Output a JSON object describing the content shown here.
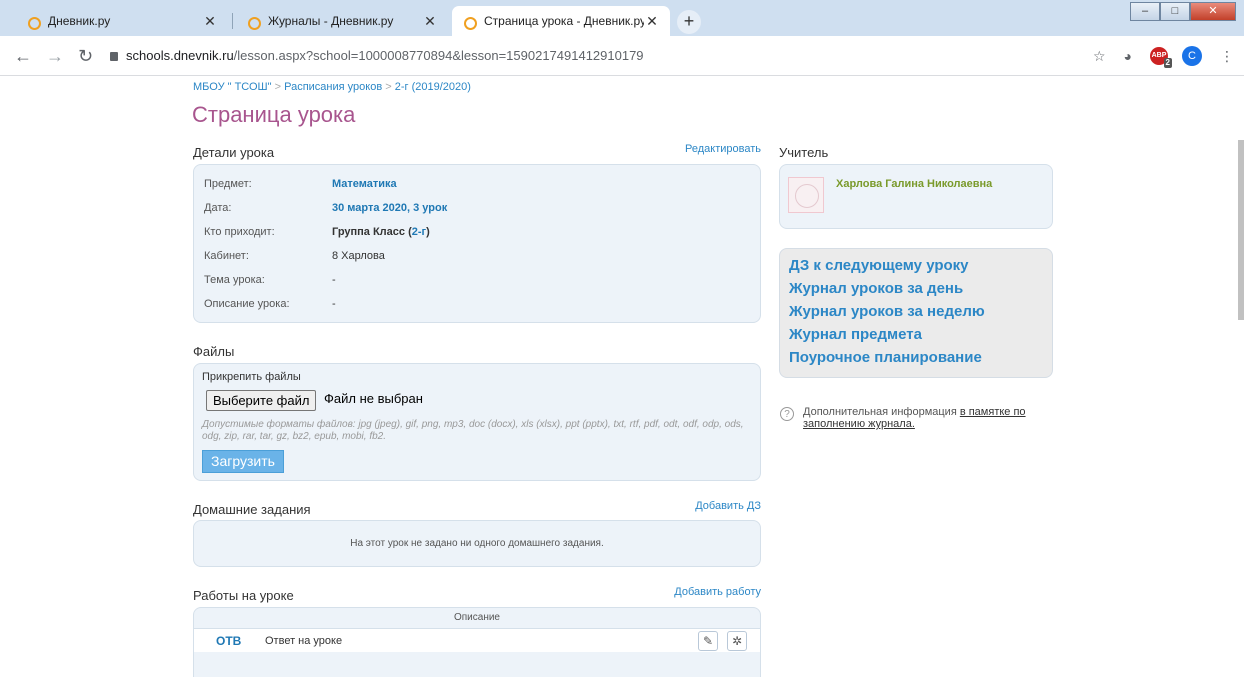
{
  "browser": {
    "tabs": [
      {
        "label": "Дневник.ру"
      },
      {
        "label": "Журналы - Дневник.ру"
      },
      {
        "label": "Страница урока - Дневник.ру"
      }
    ],
    "url_host": "schools.dnevnik.ru",
    "url_path": "/lesson.aspx?school=1000008770894&lesson=1590217491412910179",
    "abp_badge": "2",
    "profile_letter": "C"
  },
  "breadcrumb": {
    "items": [
      "МБОУ \" ТСОШ\"",
      "Расписания уроков",
      "2-г (2019/2020)"
    ],
    "separator": ">"
  },
  "page_title": "Страница урока",
  "details": {
    "heading": "Детали урока",
    "edit_link": "Редактировать",
    "rows": [
      {
        "label": "Предмет:",
        "value": "Математика"
      },
      {
        "label": "Дата:",
        "value": "30 марта 2020, 3 урок"
      },
      {
        "label": "Кто приходит:",
        "value_prefix": "Группа Класс (",
        "value_link": "2-г",
        "value_suffix": ")"
      },
      {
        "label": "Кабинет:",
        "value": "8 Харлова"
      },
      {
        "label": "Тема урока:",
        "value": "-"
      },
      {
        "label": "Описание урока:",
        "value": "-"
      }
    ]
  },
  "files": {
    "heading": "Файлы",
    "attach_label": "Прикрепить файлы",
    "choose_button": "Выберите файл",
    "no_file": "Файл не выбран",
    "formats_prefix": "Допустимые форматы файлов: ",
    "formats_list": "jpg (jpeg), gif, png, mp3, doc (docx), xls (xlsx), ppt (pptx), txt, rtf, pdf, odt, odf, odp, ods, odg, zip, rar, tar, gz, bz2, epub, mobi, fb2.",
    "upload_button": "Загрузить"
  },
  "homework": {
    "heading": "Домашние задания",
    "add_link": "Добавить ДЗ",
    "empty_text": "На этот урок не задано ни одного домашнего задания."
  },
  "works": {
    "heading": "Работы на уроке",
    "add_link": "Добавить работу",
    "column_header": "Описание",
    "rows": [
      {
        "code": "ОТВ",
        "description": "Ответ на уроке"
      }
    ]
  },
  "teacher": {
    "heading": "Учитель",
    "name": "Харлова Галина Николаевна"
  },
  "quick_links": [
    "ДЗ к следующему уроку",
    "Журнал уроков за день",
    "Журнал уроков за неделю",
    "Журнал предмета",
    "Поурочное планирование"
  ],
  "info": {
    "text": "Дополнительная информация ",
    "link": "в памятке по заполнению журнала."
  },
  "colors": {
    "title": "#a8558e",
    "link": "#2c87c6",
    "panel_bg": "#edf3f9",
    "teacher_name": "#7a9a2b"
  }
}
